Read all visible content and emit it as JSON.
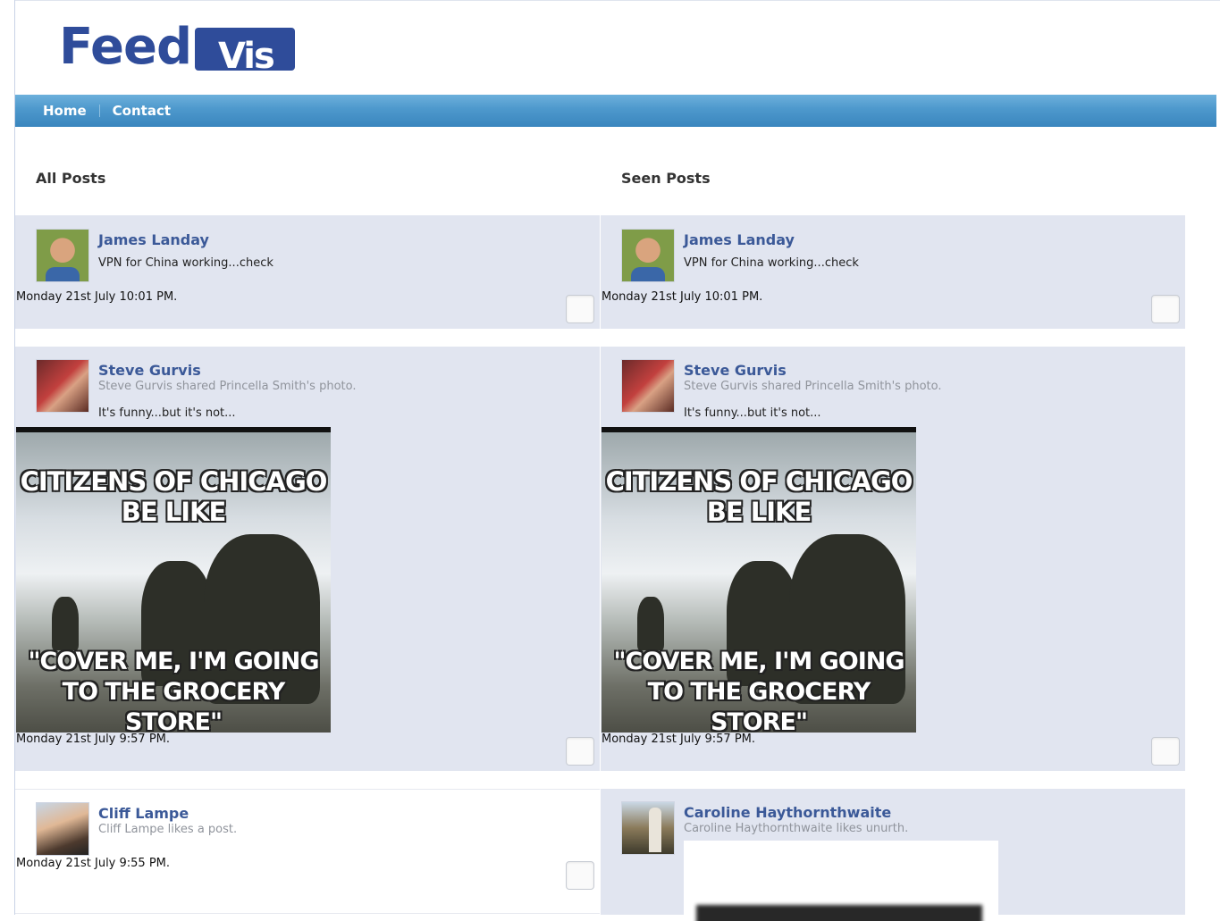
{
  "app": {
    "logo_feed": "Feed",
    "logo_vis": "Vis"
  },
  "nav": {
    "home": "Home",
    "contact": "Contact"
  },
  "columns": {
    "all_posts": "All Posts",
    "seen_posts": "Seen Posts"
  },
  "posts": {
    "james": {
      "author": "James Landay",
      "text": "VPN for China working...check",
      "timestamp": "Monday 21st July 10:01 PM."
    },
    "steve": {
      "author": "Steve Gurvis",
      "subtitle": "Steve Gurvis shared Princella Smith's photo.",
      "text": "It's funny...but it's not...",
      "image_caption_top": "CITIZENS OF CHICAGO BE LIKE",
      "image_caption_bottom": "\"COVER ME, I'M GOING TO THE GROCERY STORE\"",
      "timestamp": "Monday 21st July 9:57 PM."
    },
    "cliff": {
      "author": "Cliff Lampe",
      "subtitle": "Cliff Lampe likes a post.",
      "timestamp": "Monday 21st July 9:55 PM."
    },
    "caroline": {
      "author": "Caroline Haythornthwaite",
      "subtitle": "Caroline Haythornthwaite likes unurth."
    }
  },
  "colors": {
    "brand": "#2f4c9a",
    "nav": "#4d98cc",
    "card_bg": "#e1e5f0",
    "author": "#3b5998"
  }
}
